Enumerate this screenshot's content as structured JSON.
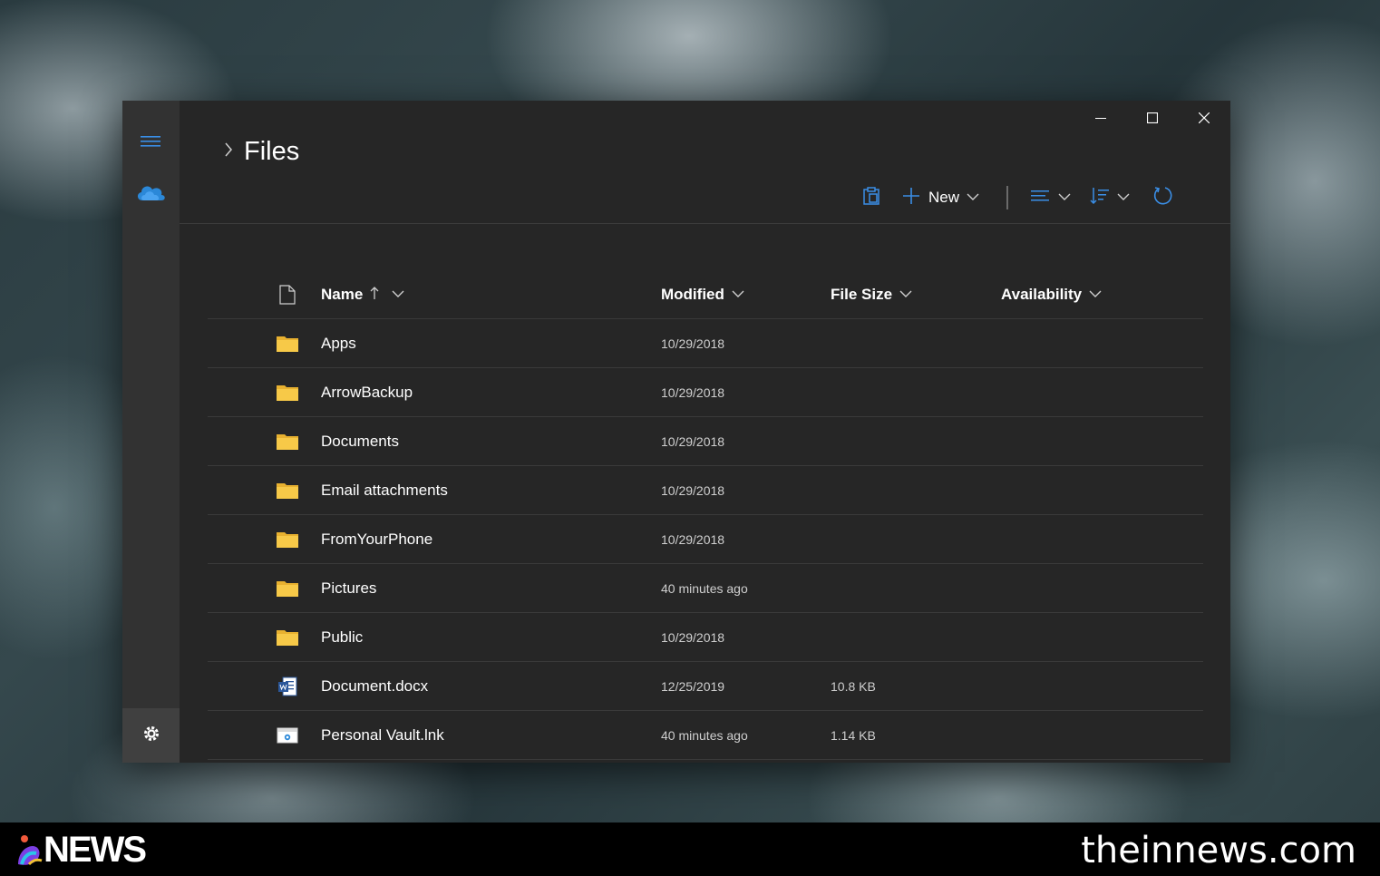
{
  "breadcrumb": {
    "title": "Files"
  },
  "toolbar": {
    "new_label": "New"
  },
  "columns": {
    "name": "Name",
    "modified": "Modified",
    "file_size": "File Size",
    "availability": "Availability"
  },
  "files": [
    {
      "name": "Apps",
      "modified": "10/29/2018",
      "size": "",
      "icon": "folder-icon"
    },
    {
      "name": "ArrowBackup",
      "modified": "10/29/2018",
      "size": "",
      "icon": "folder-icon"
    },
    {
      "name": "Documents",
      "modified": "10/29/2018",
      "size": "",
      "icon": "folder-icon"
    },
    {
      "name": "Email attachments",
      "modified": "10/29/2018",
      "size": "",
      "icon": "folder-icon"
    },
    {
      "name": "FromYourPhone",
      "modified": "10/29/2018",
      "size": "",
      "icon": "folder-icon"
    },
    {
      "name": "Pictures",
      "modified": "40 minutes ago",
      "size": "",
      "icon": "folder-icon"
    },
    {
      "name": "Public",
      "modified": "10/29/2018",
      "size": "",
      "icon": "folder-icon"
    },
    {
      "name": "Document.docx",
      "modified": "12/25/2019",
      "size": "10.8 KB",
      "icon": "word-document-icon"
    },
    {
      "name": "Personal Vault.lnk",
      "modified": "40 minutes ago",
      "size": "1.14 KB",
      "icon": "shortcut-file-icon"
    }
  ],
  "banner": {
    "logo": "NEWS",
    "site": "theinnews.com"
  },
  "colors": {
    "accent": "#3a8ee6",
    "folder": "#f7c948",
    "window_bg": "#262626",
    "rail_bg": "#323232"
  }
}
